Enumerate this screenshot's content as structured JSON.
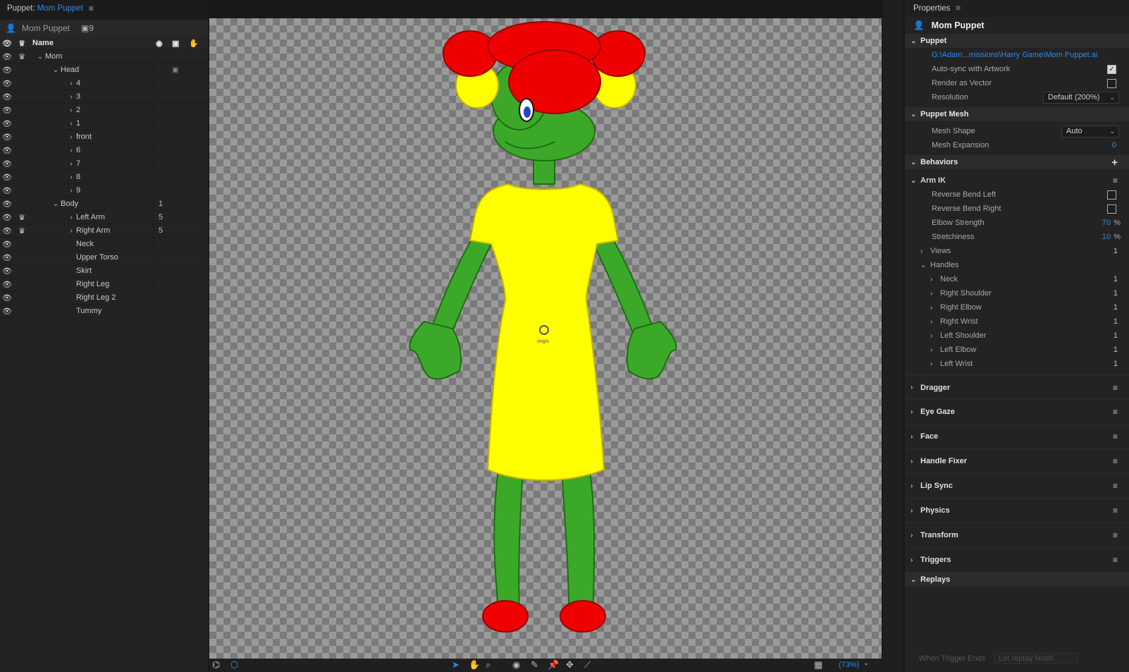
{
  "app": {
    "panel_prefix": "Puppet:",
    "panel_name": "Mom Puppet"
  },
  "puppet_row": {
    "name": "Mom Puppet",
    "count": "9"
  },
  "tree": {
    "header_name": "Name",
    "rows": [
      {
        "name": "Mom",
        "indent": 0,
        "twisty": "open",
        "crown": true,
        "num": ""
      },
      {
        "name": "Head",
        "indent": 1,
        "twisty": "open",
        "crown": false,
        "num": "",
        "icon": true
      },
      {
        "name": "4",
        "indent": 2,
        "twisty": "closed",
        "crown": false,
        "num": ""
      },
      {
        "name": "3",
        "indent": 2,
        "twisty": "closed",
        "crown": false,
        "num": ""
      },
      {
        "name": "2",
        "indent": 2,
        "twisty": "closed",
        "crown": false,
        "num": ""
      },
      {
        "name": "1",
        "indent": 2,
        "twisty": "closed",
        "crown": false,
        "num": ""
      },
      {
        "name": "front",
        "indent": 2,
        "twisty": "closed",
        "crown": false,
        "num": ""
      },
      {
        "name": "6",
        "indent": 2,
        "twisty": "closed",
        "crown": false,
        "num": ""
      },
      {
        "name": "7",
        "indent": 2,
        "twisty": "closed",
        "crown": false,
        "num": ""
      },
      {
        "name": "8",
        "indent": 2,
        "twisty": "closed",
        "crown": false,
        "num": ""
      },
      {
        "name": "9",
        "indent": 2,
        "twisty": "closed",
        "crown": false,
        "num": ""
      },
      {
        "name": "Body",
        "indent": 1,
        "twisty": "open",
        "crown": false,
        "num": "1"
      },
      {
        "name": "Left Arm",
        "indent": 2,
        "twisty": "closed",
        "crown": true,
        "num": "5"
      },
      {
        "name": "Right Arm",
        "indent": 2,
        "twisty": "closed",
        "crown": true,
        "num": "5"
      },
      {
        "name": "Neck",
        "indent": 2,
        "twisty": "none",
        "crown": false,
        "num": ""
      },
      {
        "name": "Upper Torso",
        "indent": 2,
        "twisty": "none",
        "crown": false,
        "num": ""
      },
      {
        "name": "Skirt",
        "indent": 2,
        "twisty": "none",
        "crown": false,
        "num": ""
      },
      {
        "name": "Right Leg",
        "indent": 2,
        "twisty": "none",
        "crown": false,
        "num": ""
      },
      {
        "name": "Right Leg 2",
        "indent": 2,
        "twisty": "none",
        "crown": false,
        "num": ""
      },
      {
        "name": "Tummy",
        "indent": 2,
        "twisty": "none",
        "crown": false,
        "num": ""
      }
    ]
  },
  "canvas": {
    "origin_label": "origin",
    "zoom": "(73%)"
  },
  "properties": {
    "panel_title": "Properties",
    "object_name": "Mom Puppet",
    "puppet_section": "Puppet",
    "file_path": "G:\\Adam...missions\\Harry Game\\Mom Puppet.ai",
    "auto_sync_label": "Auto-sync with Artwork",
    "auto_sync": true,
    "render_vector_label": "Render as Vector",
    "render_vector": false,
    "resolution_label": "Resolution",
    "resolution_value": "Default (200%)",
    "mesh_section": "Puppet Mesh",
    "mesh_shape_label": "Mesh Shape",
    "mesh_shape_value": "Auto",
    "mesh_expansion_label": "Mesh Expansion",
    "mesh_expansion_value": "0",
    "behaviors_section": "Behaviors",
    "arm_ik": {
      "title": "Arm IK",
      "reverse_left": "Reverse Bend Left",
      "reverse_right": "Reverse Bend Right",
      "elbow_label": "Elbow Strength",
      "elbow_value": "70",
      "stretch_label": "Stretchiness",
      "stretch_value": "10",
      "pct": "%",
      "views_label": "Views",
      "views_count": "1",
      "handles_label": "Handles",
      "handles": [
        {
          "name": "Neck",
          "count": "1"
        },
        {
          "name": "Right Shoulder",
          "count": "1"
        },
        {
          "name": "Right Elbow",
          "count": "1"
        },
        {
          "name": "Right Wrist",
          "count": "1"
        },
        {
          "name": "Left Shoulder",
          "count": "1"
        },
        {
          "name": "Left Elbow",
          "count": "1"
        },
        {
          "name": "Left Wrist",
          "count": "1"
        }
      ]
    },
    "collapsed_behaviors": [
      "Dragger",
      "Eye Gaze",
      "Face",
      "Handle Fixer",
      "Lip Sync",
      "Physics",
      "Transform",
      "Triggers"
    ],
    "replays_section": "Replays",
    "replay_footer_label": "When Trigger Ends",
    "replay_footer_value": "Let replay finish"
  },
  "colors": {
    "accent": "#2d8ceb",
    "skin": "#3ca82a",
    "dress": "#ffff00",
    "hair": "#ee0000"
  }
}
